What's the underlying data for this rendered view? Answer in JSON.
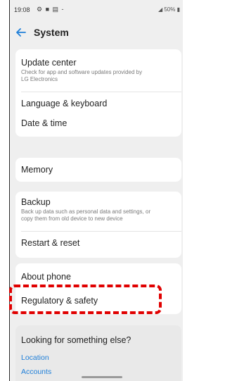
{
  "status_bar": {
    "time": "19:08",
    "icons": "⚙ ■ ▤ -",
    "battery": "◢ 50% ▮"
  },
  "app_bar": {
    "title": "System"
  },
  "settings": {
    "update_center": {
      "title": "Update center",
      "subtitle_line1": "Check for app and software updates provided by",
      "subtitle_line2": "LG Electronics"
    },
    "language_keyboard": "Language & keyboard",
    "date_time": "Date & time",
    "memory": "Memory",
    "backup": {
      "title": "Backup",
      "subtitle_line1": "Back up data such as personal data and settings, or",
      "subtitle_line2": "copy them from old device to new device"
    },
    "restart_reset": "Restart & reset",
    "about_phone": "About phone",
    "regulatory_safety": "Regulatory & safety"
  },
  "suggestions": {
    "title": "Looking for something else?",
    "links": [
      "Location",
      "Accounts"
    ]
  },
  "colors": {
    "accent": "#1f7fd8",
    "highlight": "#e00000",
    "background": "#efefef",
    "card": "#ffffff"
  }
}
